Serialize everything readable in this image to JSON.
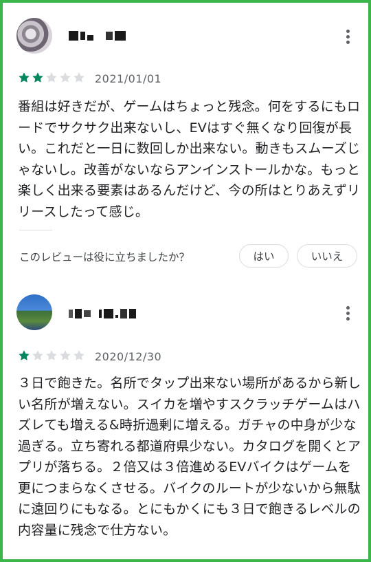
{
  "reviews": [
    {
      "avatar_icon": "user-avatar-pixelated",
      "username_mosaic": "pixelated-username",
      "rating": 2,
      "max_rating": 5,
      "date": "2021/01/01",
      "body": "番組は好きだが、ゲームはちょっと残念。何をするにもロードでサクサク出来ないし、EVはすぐ無くなり回復が長い。これだと一日に数回しか出来ない。動きもスムーズじゃないし。改善がないならアンインストールかな。もっと楽しく出来る要素はあるんだけど、今の所はとりあえずリリースしたって感じ。",
      "helpful_question": "このレビューは役に立ちましたか？",
      "yes_label": "はい",
      "no_label": "いいえ"
    },
    {
      "avatar_icon": "user-avatar-pixelated",
      "username_mosaic": "pixelated-username",
      "rating": 1,
      "max_rating": 5,
      "date": "2020/12/30",
      "body": "３日で飽きた。名所でタップ出来ない場所があるから新しい名所が増えない。スイカを増やすスクラッチゲームはハズレても増える&時折過剰に増える。ガチャの中身が少な過ぎる。立ち寄れる都道府県少ない。カタログを開くとアプリが落ちる。２倍又は３倍進めるEVバイクはゲームを更につまらなくさせる。バイクのルートが少ないから無駄に遠回りにもなる。とにもかくにも３日で飽きるレベルの内容量に残念で仕方ない。"
    }
  ],
  "colors": {
    "frame_border": "#3cb54a",
    "star_filled": "#01875f",
    "star_empty": "#dadce0",
    "text_primary": "#202124",
    "text_secondary": "#5f6368"
  }
}
